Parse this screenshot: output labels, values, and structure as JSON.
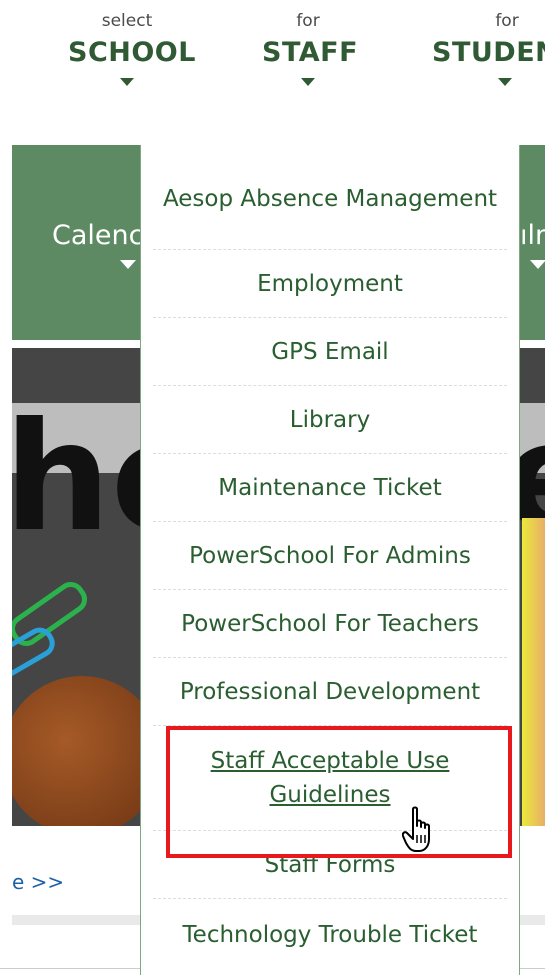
{
  "topnav": [
    {
      "small": "select",
      "big": "SCHOOL"
    },
    {
      "small": "for",
      "big": "STAFF"
    },
    {
      "small": "for",
      "big": "STUDEN"
    }
  ],
  "greenbar": {
    "left_label": "Calenc",
    "right_label": "ılm"
  },
  "hero": {
    "text_left": "he",
    "text_right": "e"
  },
  "read_more": "e >>",
  "dropdown": {
    "items": [
      "Aesop Absence Management",
      "Employment",
      "GPS Email",
      "Library",
      "Maintenance Ticket",
      "PowerSchool For Admins",
      "PowerSchool For Teachers",
      "Professional Development",
      "Staff Acceptable Use Guidelines",
      "Staff Forms",
      "Technology Trouble Ticket"
    ],
    "hovered_item": "Staff Acceptable Use Guidelines"
  },
  "colors": {
    "brand_green": "#2f5a33",
    "bar_green": "#5d8a63",
    "highlight_red": "#e8191d"
  },
  "icons": [
    "chevron-down-icon",
    "hand-pointer-cursor-icon"
  ]
}
